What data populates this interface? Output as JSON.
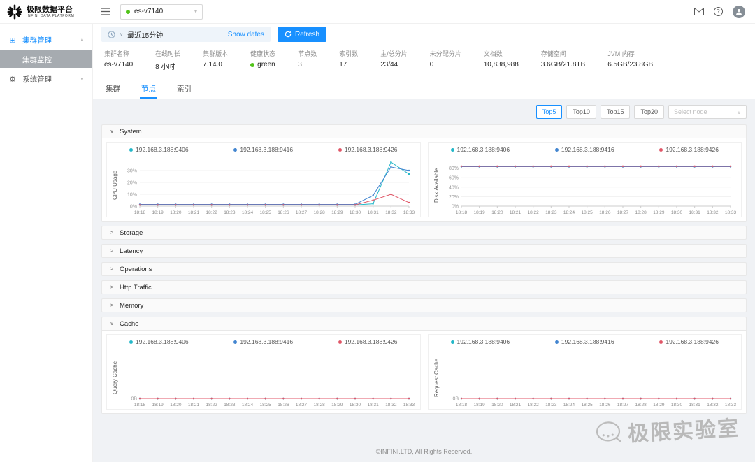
{
  "header": {
    "logo_title": "极限数据平台",
    "logo_subtitle": "INFINI DATA PLATFORM",
    "cluster_select": {
      "value": "es-v7140",
      "health_color": "#52c41a"
    }
  },
  "sidebar": {
    "cluster_group": "集群管理",
    "monitor_item": "集群监控",
    "system_group": "系统管理"
  },
  "toolbar": {
    "time_range": "最近15分钟",
    "show_dates": "Show dates",
    "refresh": "Refresh"
  },
  "stats": [
    {
      "label": "集群名称",
      "value": "es-v7140"
    },
    {
      "label": "在线时长",
      "value": "8 小时"
    },
    {
      "label": "集群版本",
      "value": "7.14.0"
    },
    {
      "label": "健康状态",
      "value": "green",
      "dot_color": "#52c41a"
    },
    {
      "label": "节点数",
      "value": "3"
    },
    {
      "label": "索引数",
      "value": "17"
    },
    {
      "label": "主/总分片",
      "value": "23/44"
    },
    {
      "label": "未分配分片",
      "value": "0"
    },
    {
      "label": "文档数",
      "value": "10,838,988"
    },
    {
      "label": "存储空间",
      "value": "3.6GB/21.8TB"
    },
    {
      "label": "JVM 内存",
      "value": "6.5GB/23.8GB"
    }
  ],
  "tabs": [
    {
      "label": "集群"
    },
    {
      "label": "节点"
    },
    {
      "label": "索引"
    }
  ],
  "top_filters": {
    "buttons": [
      "Top5",
      "Top10",
      "Top15",
      "Top20"
    ],
    "select_placeholder": "Select node"
  },
  "panels": {
    "system": "System",
    "storage": "Storage",
    "latency": "Latency",
    "operations": "Operations",
    "http_traffic": "Http Traffic",
    "memory": "Memory",
    "cache": "Cache"
  },
  "legend": [
    {
      "label": "192.168.3.188:9406",
      "color": "#23b7c8"
    },
    {
      "label": "192.168.3.188:9416",
      "color": "#4285d0"
    },
    {
      "label": "192.168.3.188:9426",
      "color": "#e05667"
    }
  ],
  "chart_data": [
    {
      "id": "cpu_usage",
      "type": "line",
      "ylabel": "CPU Usage",
      "x": [
        "18:18",
        "18:19",
        "18:20",
        "18:21",
        "18:22",
        "18:23",
        "18:24",
        "18:25",
        "18:26",
        "18:27",
        "18:28",
        "18:29",
        "18:30",
        "18:31",
        "18:32",
        "18:33"
      ],
      "ylim": [
        0,
        40
      ],
      "yticks": [
        {
          "v": 0,
          "label": "0%"
        },
        {
          "v": 10,
          "label": "10%"
        },
        {
          "v": 20,
          "label": "20%"
        },
        {
          "v": 30,
          "label": "30%"
        }
      ],
      "series": [
        {
          "name": "192.168.3.188:9406",
          "color": "#23b7c8",
          "values": [
            1,
            1,
            1,
            1,
            1,
            1,
            1,
            1,
            1,
            1,
            1,
            1,
            1,
            2,
            37,
            27
          ]
        },
        {
          "name": "192.168.3.188:9416",
          "color": "#4285d0",
          "values": [
            1.5,
            1.5,
            1.5,
            1.5,
            1.5,
            1.5,
            1.5,
            1.5,
            1.5,
            1.5,
            1.5,
            1.5,
            1.5,
            9,
            33,
            30
          ]
        },
        {
          "name": "192.168.3.188:9426",
          "color": "#e05667",
          "values": [
            1,
            1,
            1,
            1,
            1,
            1,
            1,
            1,
            1,
            1,
            1,
            1,
            1,
            5,
            10,
            3
          ]
        }
      ]
    },
    {
      "id": "disk_available",
      "type": "line",
      "ylabel": "Disk Available",
      "x": [
        "18:18",
        "18:19",
        "18:20",
        "18:21",
        "18:22",
        "18:23",
        "18:24",
        "18:25",
        "18:26",
        "18:27",
        "18:28",
        "18:29",
        "18:30",
        "18:31",
        "18:32",
        "18:33"
      ],
      "ylim": [
        0,
        100
      ],
      "yticks": [
        {
          "v": 0,
          "label": "0%"
        },
        {
          "v": 20,
          "label": "20%"
        },
        {
          "v": 40,
          "label": "40%"
        },
        {
          "v": 60,
          "label": "60%"
        },
        {
          "v": 80,
          "label": "80%"
        }
      ],
      "series": [
        {
          "name": "192.168.3.188:9406",
          "color": "#23b7c8",
          "values": [
            83,
            83,
            83,
            83,
            83,
            83,
            83,
            83,
            83,
            83,
            83,
            83,
            83,
            83,
            83,
            83
          ]
        },
        {
          "name": "192.168.3.188:9416",
          "color": "#4285d0",
          "values": [
            83,
            83,
            83,
            83,
            83,
            83,
            83,
            83,
            83,
            83,
            83,
            83,
            83,
            83,
            83,
            83
          ]
        },
        {
          "name": "192.168.3.188:9426",
          "color": "#e05667",
          "values": [
            84,
            84,
            84,
            84,
            84,
            84,
            84,
            84,
            84,
            84,
            84,
            84,
            84,
            84,
            84,
            84
          ]
        }
      ]
    },
    {
      "id": "query_cache",
      "type": "line",
      "ylabel": "Query Cache",
      "x": [
        "18:18",
        "18:19",
        "18:20",
        "18:21",
        "18:22",
        "18:23",
        "18:24",
        "18:25",
        "18:26",
        "18:27",
        "18:28",
        "18:29",
        "18:30",
        "18:31",
        "18:32",
        "18:33"
      ],
      "ylim": [
        0,
        1
      ],
      "yticks": [
        {
          "v": 0,
          "label": "0B"
        }
      ],
      "series": [
        {
          "name": "192.168.3.188:9406",
          "color": "#23b7c8",
          "values": [
            0,
            0,
            0,
            0,
            0,
            0,
            0,
            0,
            0,
            0,
            0,
            0,
            0,
            0,
            0,
            0
          ]
        },
        {
          "name": "192.168.3.188:9416",
          "color": "#4285d0",
          "values": [
            0,
            0,
            0,
            0,
            0,
            0,
            0,
            0,
            0,
            0,
            0,
            0,
            0,
            0,
            0,
            0
          ]
        },
        {
          "name": "192.168.3.188:9426",
          "color": "#e05667",
          "values": [
            0,
            0,
            0,
            0,
            0,
            0,
            0,
            0,
            0,
            0,
            0,
            0,
            0,
            0,
            0,
            0
          ]
        }
      ]
    },
    {
      "id": "request_cache",
      "type": "line",
      "ylabel": "Request Cache",
      "x": [
        "18:18",
        "18:19",
        "18:20",
        "18:21",
        "18:22",
        "18:23",
        "18:24",
        "18:25",
        "18:26",
        "18:27",
        "18:28",
        "18:29",
        "18:30",
        "18:31",
        "18:32",
        "18:33"
      ],
      "ylim": [
        0,
        1
      ],
      "yticks": [
        {
          "v": 0,
          "label": "0B"
        }
      ],
      "series": [
        {
          "name": "192.168.3.188:9406",
          "color": "#23b7c8",
          "values": [
            0,
            0,
            0,
            0,
            0,
            0,
            0,
            0,
            0,
            0,
            0,
            0,
            0,
            0,
            0,
            0
          ]
        },
        {
          "name": "192.168.3.188:9416",
          "color": "#4285d0",
          "values": [
            0,
            0,
            0,
            0,
            0,
            0,
            0,
            0,
            0,
            0,
            0,
            0,
            0,
            0,
            0,
            0
          ]
        },
        {
          "name": "192.168.3.188:9426",
          "color": "#e05667",
          "values": [
            0,
            0,
            0,
            0,
            0,
            0,
            0,
            0,
            0,
            0,
            0,
            0,
            0,
            0,
            0,
            0
          ]
        }
      ]
    }
  ],
  "footer": {
    "copyright": "©INFINI.LTD, All Rights Reserved."
  },
  "watermark": {
    "text": "极限实验室"
  }
}
